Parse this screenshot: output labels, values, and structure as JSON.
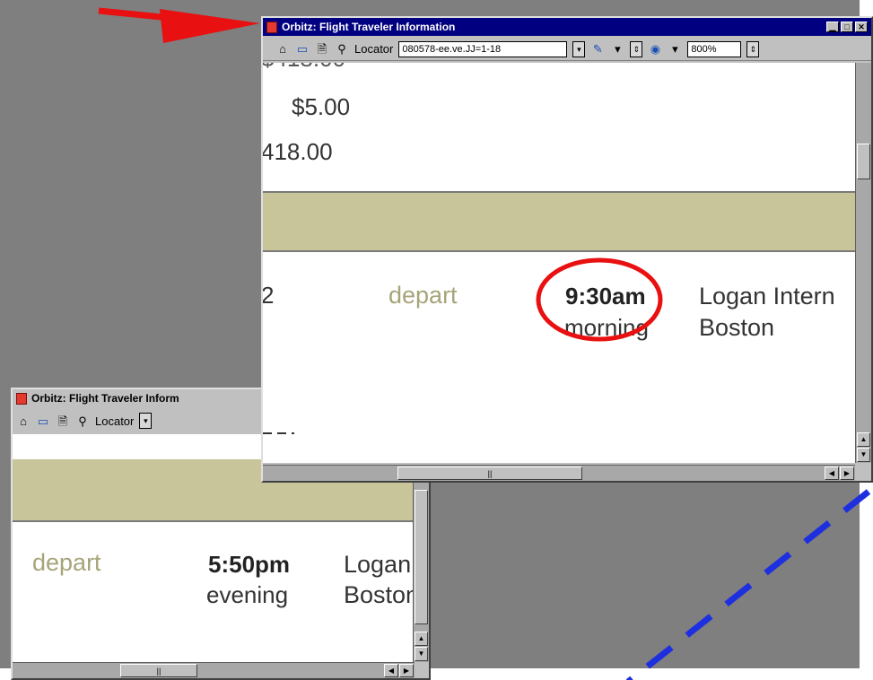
{
  "colors": {
    "desktop": "#7f7f7f",
    "titlebar_active": "#000080",
    "tan_band": "#c9c59a",
    "depart_text": "#a7a47a",
    "annotation_red": "#e81010",
    "annotation_blue": "#1e2fe0"
  },
  "front_window": {
    "title": "Orbitz: Flight Traveler Information",
    "toolbar": {
      "locator_label": "Locator",
      "locator_value": "080578-ee.ve.JJ=1-18",
      "zoom_value": "800%"
    },
    "content": {
      "fee_price": "$5.00",
      "total_price": "418.00",
      "row_prefix": "2",
      "depart_label": "depart",
      "depart_time": "9:30am",
      "time_of_day": "morning",
      "airport": "Logan Intern",
      "city": "Boston"
    }
  },
  "back_window": {
    "title": "Orbitz: Flight Traveler Inform",
    "toolbar": {
      "locator_label": "Locator"
    },
    "content": {
      "depart_label": "depart",
      "depart_time": "5:50pm",
      "time_of_day": "evening",
      "airport": "Logan",
      "city": "Boston"
    }
  },
  "icons": {
    "app": "orbitz-app-icon",
    "minimize": "minimize-icon",
    "maximize": "maximize-icon",
    "close": "close-icon",
    "home": "home-icon",
    "window": "window-icon",
    "page": "page-icon",
    "search": "search-icon",
    "globe": "globe-icon",
    "dropdown": "dropdown-arrow-icon"
  }
}
